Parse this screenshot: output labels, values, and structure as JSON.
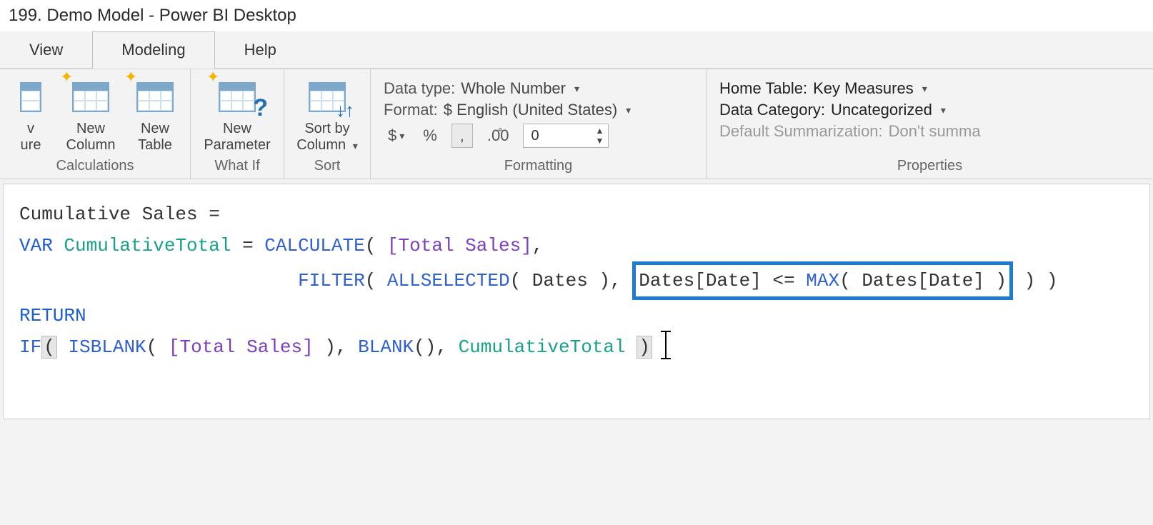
{
  "titlebar": "199. Demo Model - Power BI Desktop",
  "tabs": {
    "view": "View",
    "modeling": "Modeling",
    "help": "Help",
    "active": "modeling"
  },
  "ribbon": {
    "calculations": {
      "groupLabel": "Calculations",
      "newMeasure": "v\nure",
      "newColumn": "New\nColumn",
      "newTable": "New\nTable"
    },
    "whatif": {
      "groupLabel": "What If",
      "newParameter": "New\nParameter"
    },
    "sort": {
      "groupLabel": "Sort",
      "sortByColumn": "Sort by\nColumn"
    },
    "formatting": {
      "groupLabel": "Formatting",
      "dataTypeLabel": "Data type:",
      "dataTypeValue": "Whole Number",
      "formatLabel": "Format:",
      "formatValue": "$ English (United States)",
      "currency": "$",
      "percent": "%",
      "thousands": ",",
      "decimalBtn": ".00",
      "decimalInput": "0"
    },
    "properties": {
      "groupLabel": "Properties",
      "homeTableLabel": "Home Table:",
      "homeTableValue": "Key Measures",
      "dataCategoryLabel": "Data Category:",
      "dataCategoryValue": "Uncategorized",
      "defaultSumLabel": "Default Summarization:",
      "defaultSumValue": "Don't summa"
    }
  },
  "formula": {
    "line1_name": "Cumulative Sales",
    "eq": " = ",
    "var": "VAR",
    "varName": "CumulativeTotal",
    "calc": "CALCULATE",
    "totalSales": "[Total Sales]",
    "filter": "FILTER",
    "allselected": "ALLSELECTED",
    "datesTbl": "Dates",
    "datesCol": "Dates[Date]",
    "lte": " <= ",
    "max": "MAX",
    "return": "RETURN",
    "if": "IF",
    "isblank": "ISBLANK",
    "blank": "BLANK"
  }
}
